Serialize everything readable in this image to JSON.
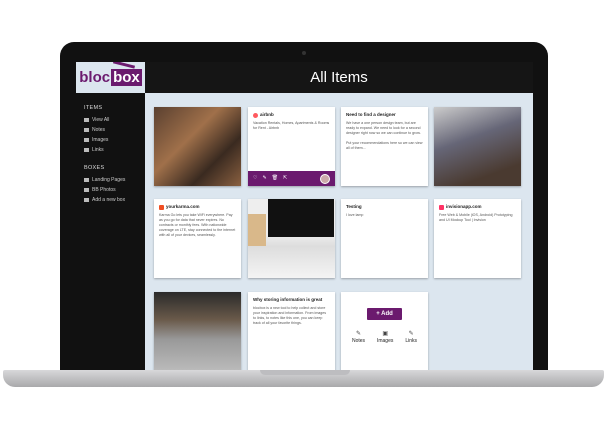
{
  "header": {
    "title": "All Items"
  },
  "logo": {
    "text_left": "bloc",
    "text_right": "box"
  },
  "sidebar": {
    "items_heading": "ITEMS",
    "items": [
      {
        "label": "View All",
        "icon": "grid-icon"
      },
      {
        "label": "Notes",
        "icon": "edit-icon"
      },
      {
        "label": "Images",
        "icon": "image-icon"
      },
      {
        "label": "Links",
        "icon": "link-icon"
      }
    ],
    "boxes_heading": "BOXES",
    "boxes": [
      {
        "label": "Landing Pages",
        "icon": "box-icon"
      },
      {
        "label": "BB Photos",
        "icon": "box-icon"
      },
      {
        "label": "Add a new box",
        "icon": "plus-icon"
      }
    ]
  },
  "cards": {
    "airbnb": {
      "title": "airbnb",
      "text": "Vacation Rentals, Homes, Apartments & Rooms for Rent - Airbnb"
    },
    "designer": {
      "title": "Need to find a designer",
      "text": "We have a one person design team, but are ready to expand. We need to look for a second designer right now so we can continue to grow.",
      "text2": "Put your recommendations here so we can view all of them..."
    },
    "karma": {
      "title": "yourkarma.com",
      "text": "Karma Go lets you take WiFi everywhere. Pay as you go for data that never expires. No contracts or monthly fees. With nationwide coverage on LTE, stay connected to the internet with all of your devices, seamlessly."
    },
    "testing": {
      "title": "Testing",
      "text": "I love lamp"
    },
    "invision": {
      "title": "invisionapp.com",
      "text": "Free Web & Mobile (iOS, Android) Prototyping and UI Mockup Tool | Invision"
    },
    "storing": {
      "title": "Why storing information is great",
      "text": "blocbox is a new tool to help collect and store your inspiration and information. From images to links, to notes like this one, you can keep track of all your favorite things."
    },
    "add": {
      "button": "+ Add",
      "options": [
        "Notes",
        "Images",
        "Links"
      ]
    }
  },
  "colors": {
    "brand": "#6b1a6e",
    "background": "#dce6ef"
  }
}
